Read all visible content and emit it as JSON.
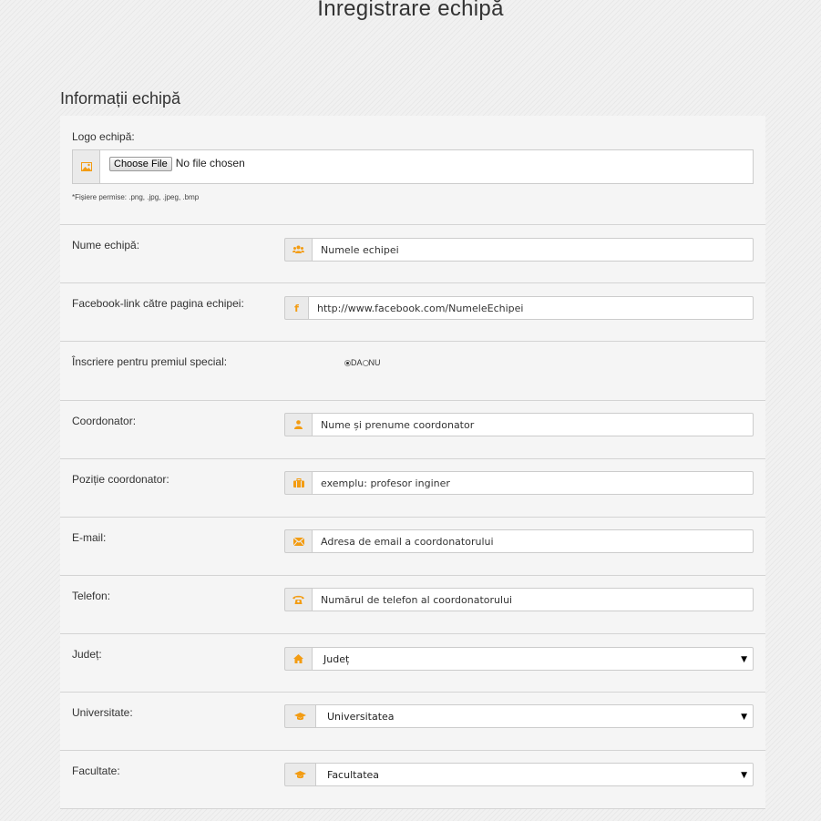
{
  "page": {
    "title": "Înregistrare echipă"
  },
  "section": {
    "title": "Informații echipă"
  },
  "logo": {
    "label": "Logo echipă:",
    "button_label": "Choose File",
    "status": "No file chosen",
    "hint": "*Fișiere permise: .png, .jpg, .jpeg, .bmp"
  },
  "team_name": {
    "label": "Nume echipă:",
    "placeholder": "Numele echipei",
    "icon": "group-icon"
  },
  "facebook": {
    "label": "Facebook-link către pagina echipei:",
    "placeholder": "http://www.facebook.com/NumeleEchipei",
    "icon": "facebook-icon"
  },
  "special_prize": {
    "label": "Înscriere pentru premiul special:",
    "options": [
      "DA",
      "NU"
    ],
    "selected": "DA"
  },
  "coordinator": {
    "label": "Coordonator:",
    "placeholder": "Nume și prenume coordonator",
    "icon": "user-icon"
  },
  "position": {
    "label": "Poziție coordonator:",
    "placeholder": "exemplu: profesor inginer",
    "icon": "briefcase-icon"
  },
  "email": {
    "label": "E-mail:",
    "placeholder": "Adresa de email a coordonatorului",
    "icon": "envelope-icon"
  },
  "phone": {
    "label": "Telefon:",
    "placeholder": "Numărul de telefon al coordonatorului",
    "icon": "phone-icon"
  },
  "county": {
    "label": "Județ:",
    "selected": "Județ",
    "icon": "home-icon"
  },
  "university": {
    "label": "Universitate:",
    "selected": "Universitatea",
    "icon": "graduation-cap-icon"
  },
  "faculty": {
    "label": "Facultate:",
    "selected": "Facultatea",
    "icon": "graduation-cap-icon"
  },
  "colors": {
    "accent": "#f39c12",
    "panel": "#f5f5f5",
    "border": "#cccccc"
  }
}
